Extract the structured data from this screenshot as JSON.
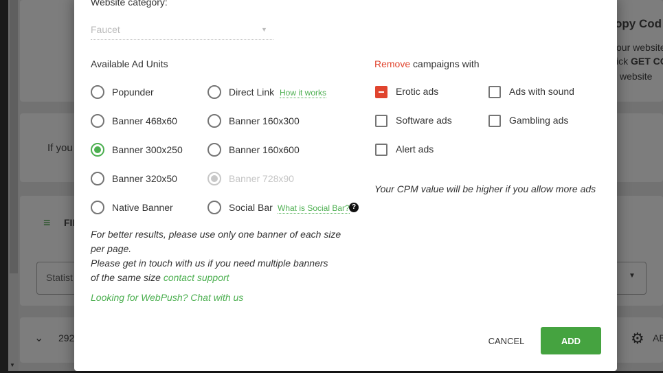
{
  "background": {
    "header_title": "opy Cod",
    "header_line1": "our website",
    "header_line2_prefix": "ick ",
    "header_line2_bold": "GET CO",
    "header_line3": "website",
    "info_text": "If you",
    "filter_label": "FIL",
    "stats_select": "Statist",
    "row_id": "292",
    "row_action": "AB"
  },
  "modal": {
    "category_label": "Website category:",
    "category_value": "Faucet",
    "ad_units_title": "Available Ad Units",
    "ad_units": [
      {
        "label": "Popunder",
        "state": "off"
      },
      {
        "label": "Direct Link",
        "state": "off",
        "link": "How it works"
      },
      {
        "label": "Banner 468x60",
        "state": "off"
      },
      {
        "label": "Banner 160x300",
        "state": "off"
      },
      {
        "label": "Banner 300x250",
        "state": "selected"
      },
      {
        "label": "Banner 160x600",
        "state": "off"
      },
      {
        "label": "Banner 320x50",
        "state": "off"
      },
      {
        "label": "Banner 728x90",
        "state": "disabled"
      },
      {
        "label": "Native Banner",
        "state": "off"
      },
      {
        "label": "Social Bar",
        "state": "off",
        "link": "What is Social Bar?"
      }
    ],
    "note_line1": "For better results, please use only one banner of each size",
    "note_line2": "per page.",
    "note_line3": "Please get in touch with us if you need multiple banners",
    "note_line4_prefix": "of the same size ",
    "note_link": "contact support",
    "webpush_link": "Looking for WebPush? Chat with us",
    "remove_word": "Remove",
    "remove_rest": " campaigns with",
    "remove_options": [
      {
        "label": "Erotic ads",
        "state": "removed"
      },
      {
        "label": "Ads with sound",
        "state": "off"
      },
      {
        "label": "Software ads",
        "state": "off"
      },
      {
        "label": "Gambling ads",
        "state": "off"
      },
      {
        "label": "Alert ads",
        "state": "off"
      }
    ],
    "cpm_note": "Your CPM value will be higher if you allow more ads",
    "cancel_label": "CANCEL",
    "add_label": "ADD"
  },
  "colors": {
    "accent": "#4caf50",
    "add_button": "#45a340",
    "remove": "#e0442e"
  }
}
